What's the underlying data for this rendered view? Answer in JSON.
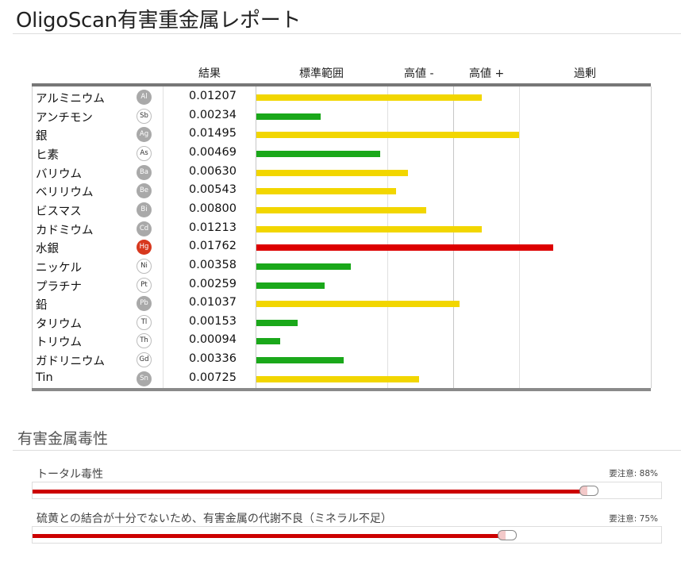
{
  "title": "OligoScan有害重金属レポート",
  "table": {
    "headers": {
      "result": "結果",
      "range": "標準範囲",
      "high_minus": "高値 -",
      "high_plus": "高値 +",
      "excess": "過剰"
    },
    "colors": {
      "yellow": "#f2d600",
      "green": "#1aa81a",
      "red": "#dd0000"
    },
    "rows": [
      {
        "name": "アルミニウム",
        "symbol": "Al",
        "symbol_style": "grey",
        "value": "0.01207",
        "level": 0.365,
        "color": "yellow"
      },
      {
        "name": "アンチモン",
        "symbol": "Sb",
        "symbol_style": "white",
        "value": "0.00234",
        "level": 0.104,
        "color": "green"
      },
      {
        "name": "銀",
        "symbol": "Ag",
        "symbol_style": "grey",
        "value": "0.01495",
        "level": 0.426,
        "color": "yellow"
      },
      {
        "name": "ヒ素",
        "symbol": "As",
        "symbol_style": "white",
        "value": "0.00469",
        "level": 0.201,
        "color": "green"
      },
      {
        "name": "バリウム",
        "symbol": "Ba",
        "symbol_style": "grey",
        "value": "0.00630",
        "level": 0.245,
        "color": "yellow"
      },
      {
        "name": "ベリリウム",
        "symbol": "Be",
        "symbol_style": "grey",
        "value": "0.00543",
        "level": 0.226,
        "color": "yellow"
      },
      {
        "name": "ビスマス",
        "symbol": "Bi",
        "symbol_style": "grey",
        "value": "0.00800",
        "level": 0.275,
        "color": "yellow"
      },
      {
        "name": "カドミウム",
        "symbol": "Cd",
        "symbol_style": "grey",
        "value": "0.01213",
        "level": 0.365,
        "color": "yellow"
      },
      {
        "name": "水銀",
        "symbol": "Hg",
        "symbol_style": "red",
        "value": "0.01762",
        "level": 0.481,
        "color": "red"
      },
      {
        "name": "ニッケル",
        "symbol": "Ni",
        "symbol_style": "white",
        "value": "0.00358",
        "level": 0.153,
        "color": "green"
      },
      {
        "name": "プラチナ",
        "symbol": "Pt",
        "symbol_style": "white",
        "value": "0.00259",
        "level": 0.111,
        "color": "green"
      },
      {
        "name": "鉛",
        "symbol": "Pb",
        "symbol_style": "grey",
        "value": "0.01037",
        "level": 0.329,
        "color": "yellow"
      },
      {
        "name": "タリウム",
        "symbol": "Tl",
        "symbol_style": "white",
        "value": "0.00153",
        "level": 0.067,
        "color": "green"
      },
      {
        "name": "トリウム",
        "symbol": "Th",
        "symbol_style": "white",
        "value": "0.00094",
        "level": 0.038,
        "color": "green"
      },
      {
        "name": "ガドリニウム",
        "symbol": "Gd",
        "symbol_style": "white",
        "value": "0.00336",
        "level": 0.141,
        "color": "green"
      },
      {
        "name": "Tin",
        "symbol": "Sn",
        "symbol_style": "grey",
        "value": "0.00725",
        "level": 0.263,
        "color": "yellow"
      }
    ]
  },
  "toxicity": {
    "title": "有害金属毒性",
    "items": [
      {
        "label": "トータル毒性",
        "note": "要注意: 88%",
        "percent": 88
      },
      {
        "label": "硫黄との結合が十分でないため、有害金属の代謝不良（ミネラル不足）",
        "note": "要注意: 75%",
        "percent": 75
      }
    ]
  }
}
